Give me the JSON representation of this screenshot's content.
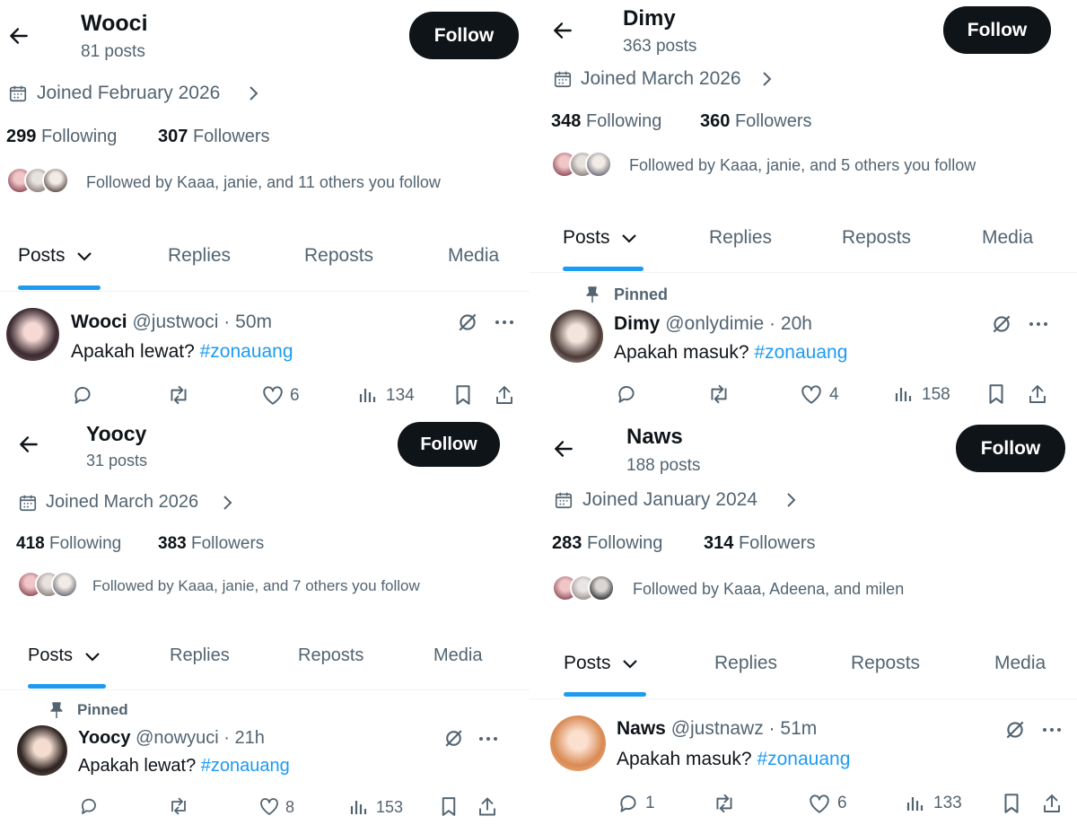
{
  "panels": [
    {
      "name": "Wooci",
      "posts_count": "81 posts",
      "follow_label": "Follow",
      "joined": "Joined February 2026",
      "following_count": "299",
      "following_label": "Following",
      "followers_count": "307",
      "followers_label": "Followers",
      "followed_by": "Followed by Kaaa, janie, and 11 others you follow",
      "tabs": [
        "Posts",
        "Replies",
        "Reposts",
        "Media"
      ],
      "post": {
        "pinned": false,
        "display_name": "Wooci",
        "handle_time": "@justwoci · 50m",
        "text": "Apakah lewat?",
        "hashtag": "#zonauang",
        "replies": "",
        "likes": "6",
        "views": "134"
      }
    },
    {
      "name": "Dimy",
      "posts_count": "363 posts",
      "follow_label": "Follow",
      "joined": "Joined March 2026",
      "following_count": "348",
      "following_label": "Following",
      "followers_count": "360",
      "followers_label": "Followers",
      "followed_by": "Followed by Kaaa, janie, and 5 others you follow",
      "tabs": [
        "Posts",
        "Replies",
        "Reposts",
        "Media"
      ],
      "post": {
        "pinned": true,
        "pinned_label": "Pinned",
        "display_name": "Dimy",
        "handle_time": "@onlydimie · 20h",
        "text": "Apakah masuk?",
        "hashtag": "#zonauang",
        "replies": "",
        "likes": "4",
        "views": "158"
      }
    },
    {
      "name": "Yoocy",
      "posts_count": "31 posts",
      "follow_label": "Follow",
      "joined": "Joined March 2026",
      "following_count": "418",
      "following_label": "Following",
      "followers_count": "383",
      "followers_label": "Followers",
      "followed_by": "Followed by Kaaa, janie, and 7 others you follow",
      "tabs": [
        "Posts",
        "Replies",
        "Reposts",
        "Media"
      ],
      "post": {
        "pinned": true,
        "pinned_label": "Pinned",
        "display_name": "Yoocy",
        "handle_time": "@nowyuci · 21h",
        "text": "Apakah lewat?",
        "hashtag": "#zonauang",
        "replies": "",
        "likes": "8",
        "views": "153"
      }
    },
    {
      "name": "Naws",
      "posts_count": "188 posts",
      "follow_label": "Follow",
      "joined": "Joined January 2024",
      "following_count": "283",
      "following_label": "Following",
      "followers_count": "314",
      "followers_label": "Followers",
      "followed_by": "Followed by Kaaa, Adeena, and milen",
      "tabs": [
        "Posts",
        "Replies",
        "Reposts",
        "Media"
      ],
      "post": {
        "pinned": false,
        "display_name": "Naws",
        "handle_time": "@justnawz · 51m",
        "text": "Apakah masuk?",
        "hashtag": "#zonauang",
        "replies": "1",
        "likes": "6",
        "views": "133"
      }
    }
  ],
  "icons": [
    "back-arrow-icon",
    "calendar-icon",
    "chevron-right-icon",
    "chevron-down-icon",
    "pin-icon",
    "grok-icon",
    "more-icon",
    "reply-icon",
    "repost-icon",
    "like-icon",
    "views-icon",
    "bookmark-icon",
    "share-icon"
  ],
  "colors": {
    "accent": "#1d9bf0",
    "text": "#0f1419",
    "secondary": "#536471",
    "button": "#0f1419"
  }
}
